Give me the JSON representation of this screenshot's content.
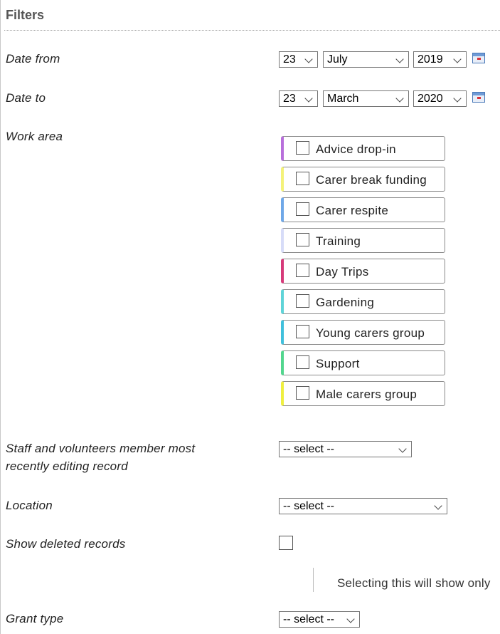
{
  "header": {
    "title": "Filters"
  },
  "date_from": {
    "label": "Date from",
    "day": "23",
    "month": "July",
    "year": "2019"
  },
  "date_to": {
    "label": "Date to",
    "day": "23",
    "month": "March",
    "year": "2020"
  },
  "work_area": {
    "label": "Work area",
    "items": [
      {
        "label": "Advice drop-in",
        "color": "#b86fdb"
      },
      {
        "label": "Carer break funding",
        "color": "#f4f27a"
      },
      {
        "label": "Carer respite",
        "color": "#6fa8e8"
      },
      {
        "label": "Training",
        "color": "#d7dcf8"
      },
      {
        "label": "Day Trips",
        "color": "#d63a7a"
      },
      {
        "label": "Gardening",
        "color": "#5fd4d8"
      },
      {
        "label": "Young carers group",
        "color": "#40c0dc"
      },
      {
        "label": "Support",
        "color": "#52d68e"
      },
      {
        "label": "Male carers group",
        "color": "#efef40"
      }
    ]
  },
  "staff": {
    "label_line1": "Staff and volunteers member most",
    "label_line2": "recently editing record",
    "value": "-- select --"
  },
  "location": {
    "label": "Location",
    "value": "-- select --"
  },
  "deleted": {
    "label": "Show deleted records",
    "note": "Selecting this will show only"
  },
  "grant_type": {
    "label": "Grant type",
    "value": "-- select --"
  }
}
